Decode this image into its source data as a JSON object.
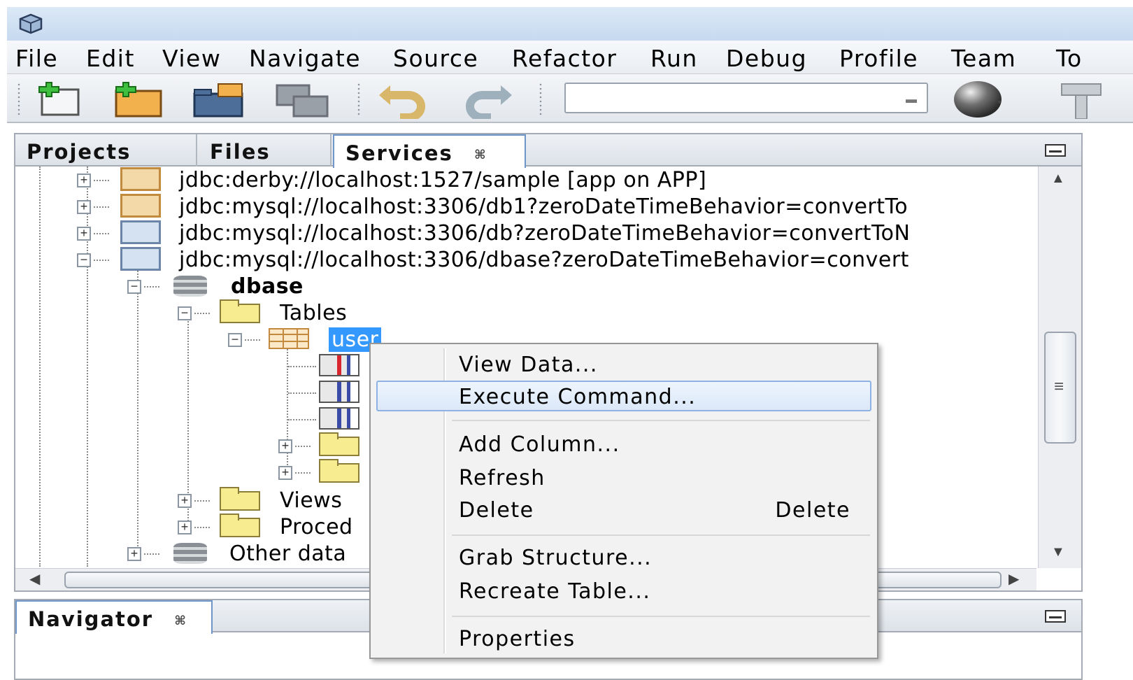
{
  "menubar": {
    "items": [
      "File",
      "Edit",
      "View",
      "Navigate",
      "Source",
      "Refactor",
      "Run",
      "Debug",
      "Profile",
      "Team",
      "To"
    ]
  },
  "toolbar": {
    "buttons": [
      "new-file-icon",
      "new-project-icon",
      "open-project-icon",
      "save-all-icon",
      "undo-icon",
      "redo-icon",
      "globe-icon",
      "hammer-icon"
    ],
    "config_combo_value": ""
  },
  "panel": {
    "tabs": [
      "Projects",
      "Files",
      "Services"
    ],
    "active_tab": "Services",
    "tab_close_glyph": "⌘"
  },
  "tree": {
    "connections": [
      "jdbc:derby://localhost:1527/sample [app on APP]",
      "jdbc:mysql://localhost:3306/db1?zeroDateTimeBehavior=convertTo",
      "jdbc:mysql://localhost:3306/db?zeroDateTimeBehavior=convertToN",
      "jdbc:mysql://localhost:3306/dbase?zeroDateTimeBehavior=convert"
    ],
    "schema": "dbase",
    "tables_label": "Tables",
    "table_name": "user",
    "views_label": "Views",
    "procedures_label": "Proced",
    "other_label": "Other data"
  },
  "navigator": {
    "tab": "Navigator",
    "close_glyph": "⌘"
  },
  "context_menu": {
    "items": [
      {
        "label": "View Data...",
        "shortcut": ""
      },
      {
        "label": "Execute Command...",
        "shortcut": "",
        "highlighted": true
      },
      {
        "label": "Add Column...",
        "shortcut": ""
      },
      {
        "label": "Refresh",
        "shortcut": ""
      },
      {
        "label": "Delete",
        "shortcut": "Delete"
      },
      {
        "label": "Grab Structure...",
        "shortcut": ""
      },
      {
        "label": "Recreate Table...",
        "shortcut": ""
      },
      {
        "label": "Properties",
        "shortcut": ""
      }
    ]
  },
  "colors": {
    "selection": "#3399ff",
    "menu_hover_border": "#8db2e3",
    "folder_fill": "#f8ec90"
  }
}
